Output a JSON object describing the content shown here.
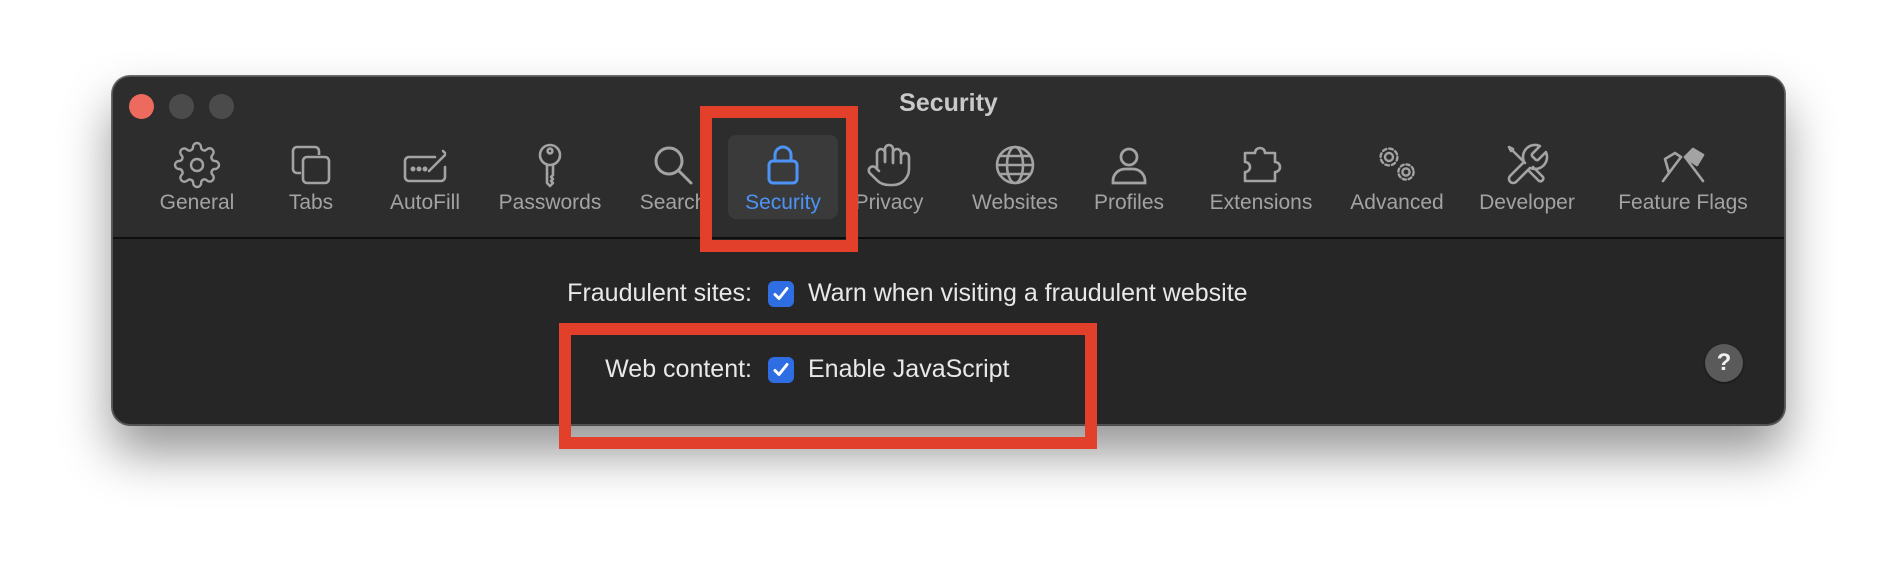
{
  "window": {
    "title": "Security"
  },
  "toolbar": {
    "tabs": [
      {
        "label": "General",
        "icon": "gear-icon"
      },
      {
        "label": "Tabs",
        "icon": "tabs-icon"
      },
      {
        "label": "AutoFill",
        "icon": "autofill-icon"
      },
      {
        "label": "Passwords",
        "icon": "key-icon"
      },
      {
        "label": "Search",
        "icon": "search-icon"
      },
      {
        "label": "Security",
        "icon": "lock-icon",
        "selected": true
      },
      {
        "label": "Privacy",
        "icon": "hand-icon"
      },
      {
        "label": "Websites",
        "icon": "globe-icon"
      },
      {
        "label": "Profiles",
        "icon": "person-icon"
      },
      {
        "label": "Extensions",
        "icon": "puzzle-icon"
      },
      {
        "label": "Advanced",
        "icon": "gears-icon"
      },
      {
        "label": "Developer",
        "icon": "tools-icon"
      },
      {
        "label": "Feature Flags",
        "icon": "flags-icon"
      }
    ]
  },
  "settings": {
    "fraudulent": {
      "label": "Fraudulent sites:",
      "option": "Warn when visiting a fraudulent website",
      "checked": true
    },
    "web_content": {
      "label": "Web content:",
      "option": "Enable JavaScript",
      "checked": true
    }
  },
  "help": {
    "label": "?"
  },
  "colors": {
    "window_bg": "#262626",
    "toolbar_bg": "#2d2d2d",
    "accent": "#4d93f7",
    "checkbox": "#2f6de3",
    "highlight": "#e3402b",
    "close_button": "#ec6a5e"
  }
}
